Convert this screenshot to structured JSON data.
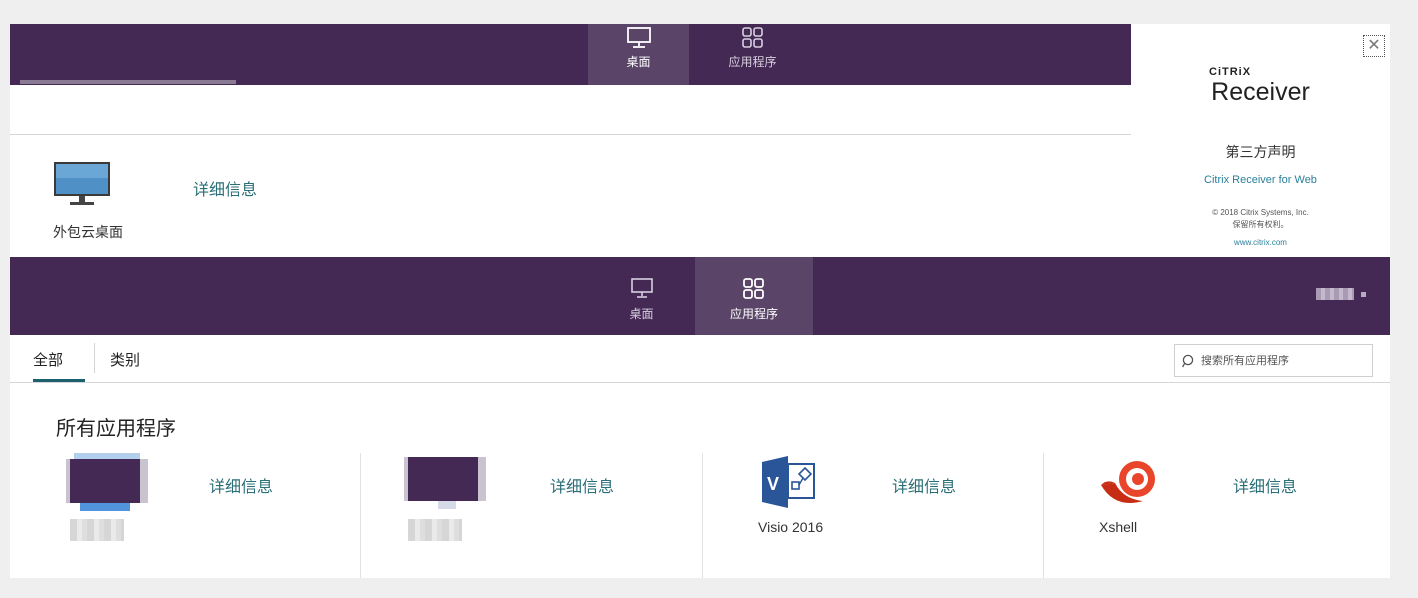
{
  "top_panel": {
    "tabs": [
      {
        "label": "桌面",
        "icon": "desktop-icon",
        "active": true
      },
      {
        "label": "应用程序",
        "icon": "apps-grid-icon",
        "active": false
      }
    ],
    "desktop_item": {
      "name": "外包云桌面",
      "details_label": "详细信息",
      "icon": "monitor-icon"
    }
  },
  "about": {
    "brand": "CiTRiX",
    "product": "Receiver",
    "third_party": "第三方声明",
    "web_link": "Citrix Receiver for Web",
    "copyright": "© 2018 Citrix Systems, Inc.",
    "rights": "保留所有权利。",
    "url": "www.citrix.com",
    "close_icon": "close-icon"
  },
  "bottom_panel": {
    "tabs": [
      {
        "label": "桌面",
        "icon": "desktop-icon",
        "active": false
      },
      {
        "label": "应用程序",
        "icon": "apps-grid-icon",
        "active": true
      }
    ],
    "filters": [
      {
        "label": "全部",
        "active": true
      },
      {
        "label": "类别",
        "active": false
      }
    ],
    "search": {
      "placeholder": "搜索所有应用程序",
      "icon": "search-icon"
    },
    "section_title": "所有应用程序",
    "apps": [
      {
        "name": "",
        "details_label": "详细信息",
        "icon": "blurred-app-icon"
      },
      {
        "name": "",
        "details_label": "详细信息",
        "icon": "blurred-app-icon"
      },
      {
        "name": "Visio 2016",
        "details_label": "详细信息",
        "icon": "visio-icon"
      },
      {
        "name": "Xshell",
        "details_label": "详细信息",
        "icon": "xshell-icon"
      }
    ]
  },
  "colors": {
    "header_purple": "#432953",
    "active_tab": "#5a4468",
    "accent_teal": "#2a6f78",
    "link_blue": "#2a7f9a",
    "visio_blue": "#2a5599",
    "xshell_red": "#d9381e"
  }
}
